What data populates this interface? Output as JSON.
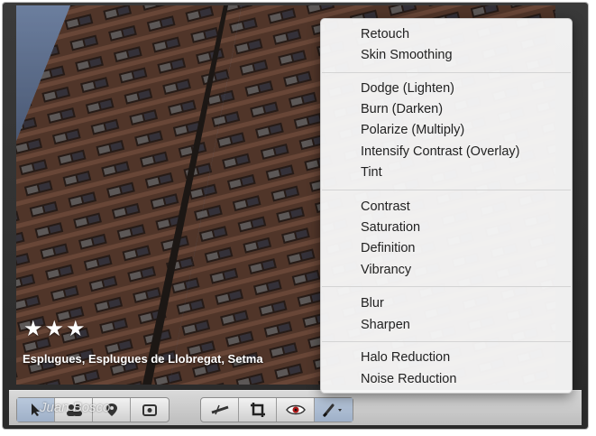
{
  "photo": {
    "rating_stars": "★★★",
    "caption": "Esplugues, Esplugues de Llobregat, Setma"
  },
  "watermark": "Juan Bosco",
  "menu": {
    "items": [
      "Retouch",
      "Skin Smoothing",
      "Dodge (Lighten)",
      "Burn (Darken)",
      "Polarize (Multiply)",
      "Intensify Contrast (Overlay)",
      "Tint",
      "Contrast",
      "Saturation",
      "Definition",
      "Vibrancy",
      "Blur",
      "Sharpen",
      "Halo Reduction",
      "Noise Reduction"
    ]
  },
  "toolbar": {
    "icons": [
      "pointer-icon",
      "people-icon",
      "map-pin-icon",
      "info-icon",
      "straighten-icon",
      "crop-icon",
      "red-eye-icon",
      "brush-icon"
    ]
  },
  "colors": {
    "menu_bg": "#f6f6f6",
    "menu_text": "#222222",
    "toolbar_bg": "#c9c9c9",
    "active_tool": "#a9b9d1"
  }
}
